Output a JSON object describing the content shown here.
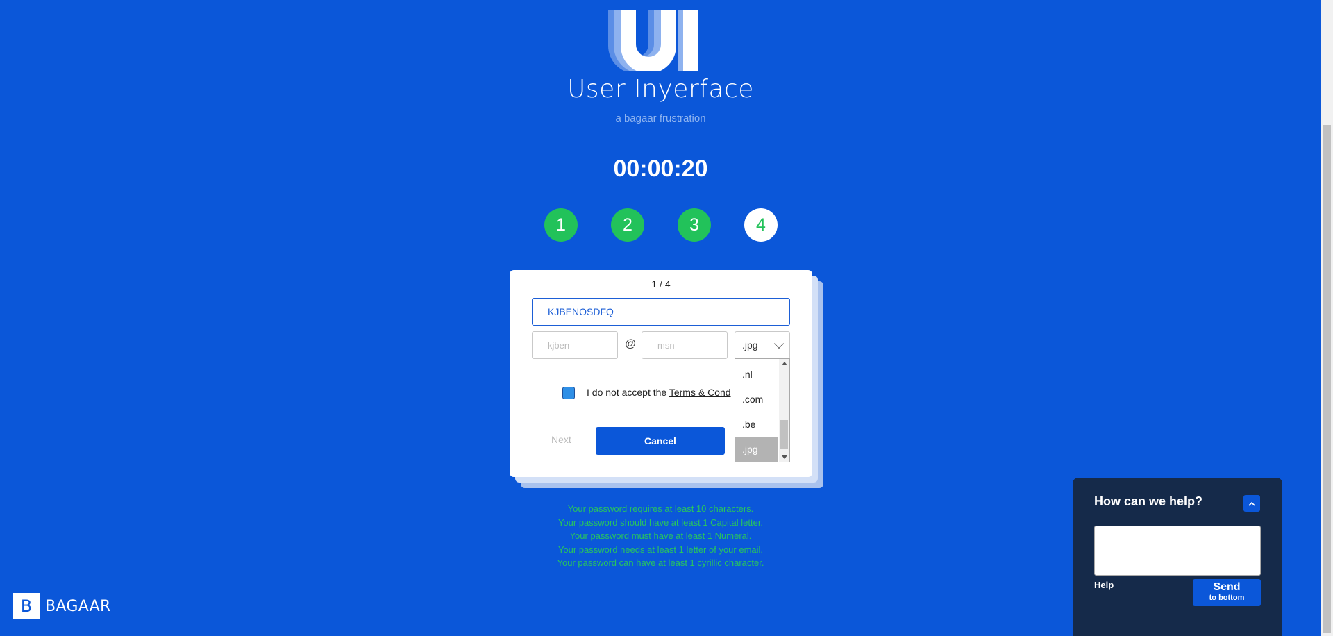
{
  "app": {
    "title": "User Inyerface",
    "subtitle": "a bagaar frustration",
    "timer": "00:00:20"
  },
  "steps": [
    {
      "label": "1",
      "state": "done"
    },
    {
      "label": "2",
      "state": "done"
    },
    {
      "label": "3",
      "state": "done"
    },
    {
      "label": "4",
      "state": "active"
    }
  ],
  "card": {
    "pager": "1 / 4",
    "password_value": "KJBENOSDFQ",
    "email_name_placeholder": "kjben",
    "at_symbol": "@",
    "domain_placeholder": "msn",
    "tld_selected": ".jpg",
    "tld_options": [
      ".nl",
      ".com",
      ".be",
      ".jpg"
    ],
    "terms_prefix": "I do not accept the ",
    "terms_link": "Terms & Cond",
    "next_label": "Next",
    "cancel_label": "Cancel"
  },
  "hints": [
    "Your password requires at least 10 characters.",
    "Your password should have at least 1 Capital letter.",
    "Your password must have at least 1 Numeral.",
    "Your password needs at least 1 letter of your email.",
    "Your password can have at least 1 cyrillic character."
  ],
  "brand": {
    "box_letter": "B",
    "word": "BAGAAR"
  },
  "help": {
    "title": "How can we help?",
    "collapse_icon": "chevron-up-icon",
    "link": "Help",
    "send_label": "Send",
    "send_sub": "to bottom"
  },
  "colors": {
    "background": "#0b57d9",
    "success": "#22c25a",
    "help_panel": "#152a4a"
  }
}
